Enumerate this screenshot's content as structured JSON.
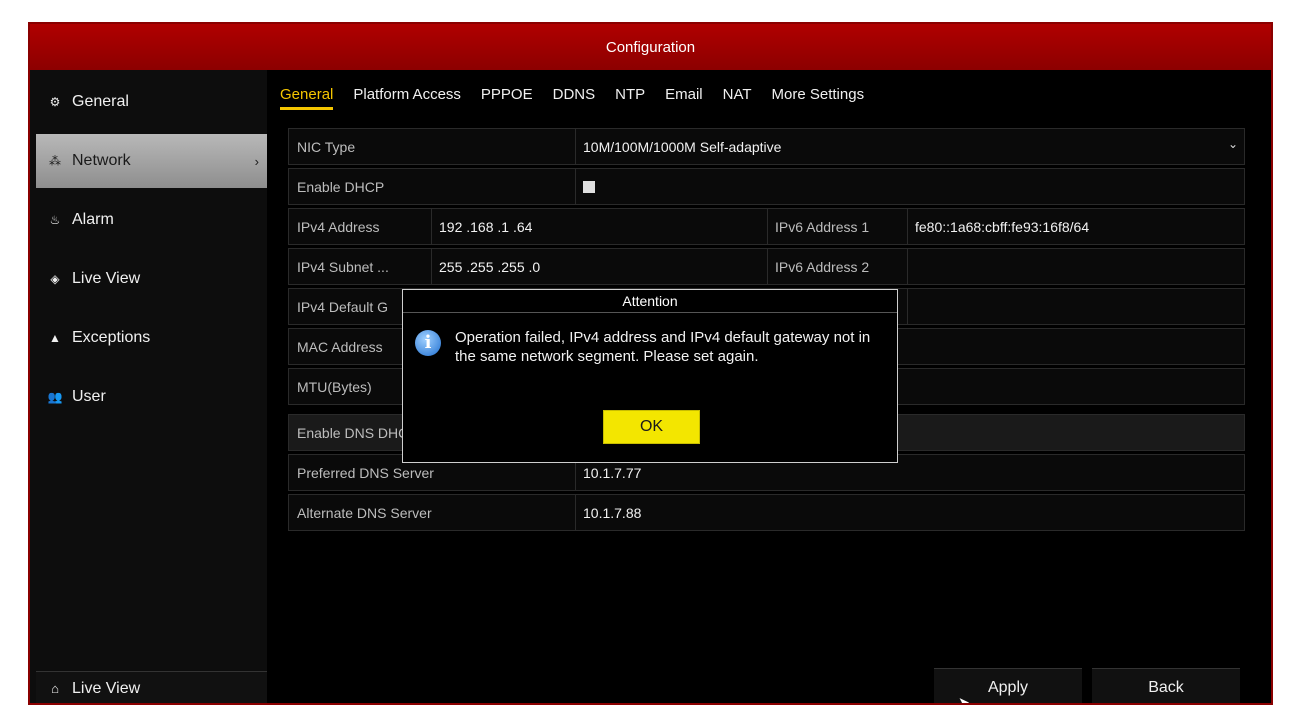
{
  "window": {
    "title": "Configuration"
  },
  "sidebar": {
    "items": [
      {
        "label": "General",
        "icon": "gear-icon",
        "glyph": "⚙"
      },
      {
        "label": "Network",
        "icon": "network-icon",
        "glyph": "⁂",
        "chevron": "›"
      },
      {
        "label": "Alarm",
        "icon": "alarm-icon",
        "glyph": "♨"
      },
      {
        "label": "Live View",
        "icon": "eye-icon",
        "glyph": "◈"
      },
      {
        "label": "Exceptions",
        "icon": "warning-icon",
        "glyph": "▲"
      },
      {
        "label": "User",
        "icon": "users-icon",
        "glyph": "👥"
      }
    ],
    "footer": {
      "label": "Live View",
      "icon": "home-icon",
      "glyph": "⌂"
    }
  },
  "tabs": [
    "General",
    "Platform Access",
    "PPPOE",
    "DDNS",
    "NTP",
    "Email",
    "NAT",
    "More Settings"
  ],
  "form": {
    "nic_type": {
      "label": "NIC Type",
      "value": "10M/100M/1000M Self-adaptive",
      "arrow": "⌄"
    },
    "enable_dhcp": {
      "label": "Enable DHCP"
    },
    "ipv4_address": {
      "label": "IPv4 Address",
      "value": "192 .168 .1    .64"
    },
    "ipv6_address_1": {
      "label": "IPv6 Address 1",
      "value": "fe80::1a68:cbff:fe93:16f8/64"
    },
    "ipv4_subnet": {
      "label": "IPv4 Subnet ...",
      "value": "255 .255 .255 .0"
    },
    "ipv6_address_2": {
      "label": "IPv6 Address 2",
      "value": ""
    },
    "ipv4_gateway": {
      "label": "IPv4 Default G",
      "value": ""
    },
    "mac_address": {
      "label": "MAC Address",
      "value": ""
    },
    "mtu": {
      "label": "MTU(Bytes)",
      "value": ""
    },
    "enable_dns": {
      "label": "Enable DNS DHCP"
    },
    "preferred_dns": {
      "label": "Preferred DNS Server",
      "value": "10.1.7.77"
    },
    "alternate_dns": {
      "label": "Alternate DNS Server",
      "value": "10.1.7.88"
    }
  },
  "dialog": {
    "title": "Attention",
    "message": "Operation failed, IPv4 address and IPv4 default gateway not in the same network segment. Please set again.",
    "ok_label": "OK"
  },
  "buttons": {
    "apply": "Apply",
    "back": "Back"
  },
  "colors": {
    "title_bar": "#a00000",
    "active_tab": "#f5c600",
    "ok_button": "#f3e600"
  }
}
